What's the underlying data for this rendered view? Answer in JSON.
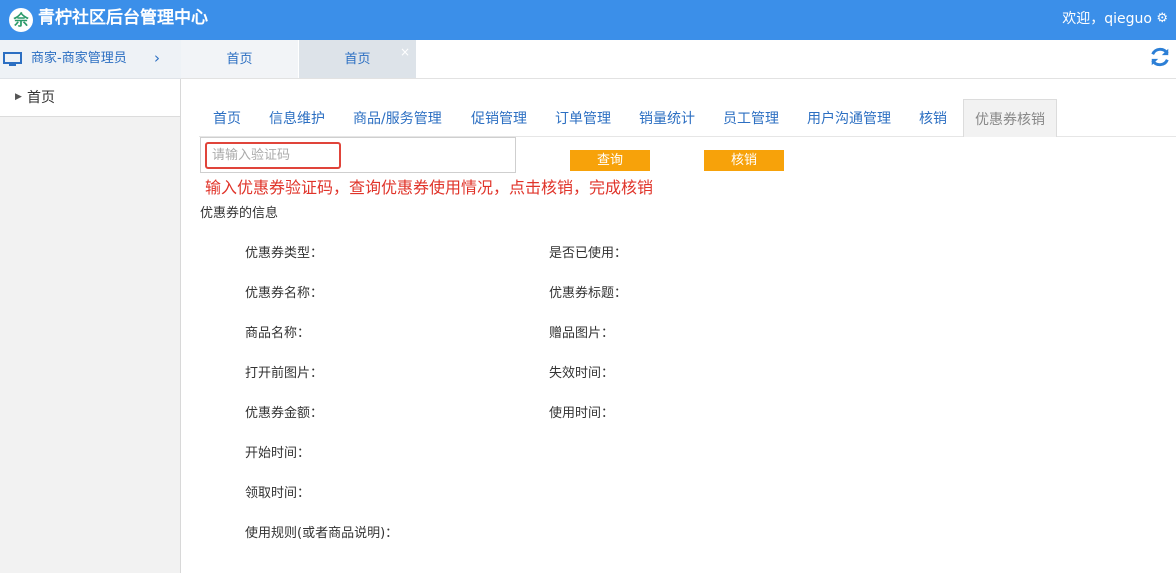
{
  "app": {
    "title": "青柠社区后台管理中心",
    "logo_glyph": "佘",
    "welcome": "欢迎，qieguo",
    "gear_icon": "gear-icon"
  },
  "sidebar": {
    "role": "商家-商家管理员",
    "items": [
      {
        "label": "首页"
      }
    ]
  },
  "page_tabs": [
    {
      "label": "首页"
    },
    {
      "label": "首页",
      "close": "×"
    }
  ],
  "sub_tabs": [
    {
      "label": "首页"
    },
    {
      "label": "信息维护"
    },
    {
      "label": "商品/服务管理"
    },
    {
      "label": "促销管理"
    },
    {
      "label": "订单管理"
    },
    {
      "label": "销量统计"
    },
    {
      "label": "员工管理"
    },
    {
      "label": "用户沟通管理"
    },
    {
      "label": "核销"
    },
    {
      "label": "优惠券核销",
      "active": true
    }
  ],
  "search": {
    "placeholder": "请输入验证码",
    "value": ""
  },
  "buttons": {
    "query": "查询",
    "verify": "核销"
  },
  "hint": "输入优惠券验证码，查询优惠券使用情况，点击核销，完成核销",
  "section_title": "优惠券的信息",
  "fields": {
    "left": [
      "优惠券类型：",
      "优惠券名称：",
      "商品名称：",
      "打开前图片：",
      "优惠券金额：",
      "开始时间：",
      "领取时间：",
      "使用规则(或者商品说明)："
    ],
    "right": [
      "是否已使用：",
      "优惠券标题：",
      "赠品图片：",
      "失效时间：",
      "使用时间："
    ]
  },
  "colors": {
    "topbar": "#3b8fe9",
    "link": "#2c6fc2",
    "button": "#f7a20a",
    "hint": "#e0342a"
  }
}
